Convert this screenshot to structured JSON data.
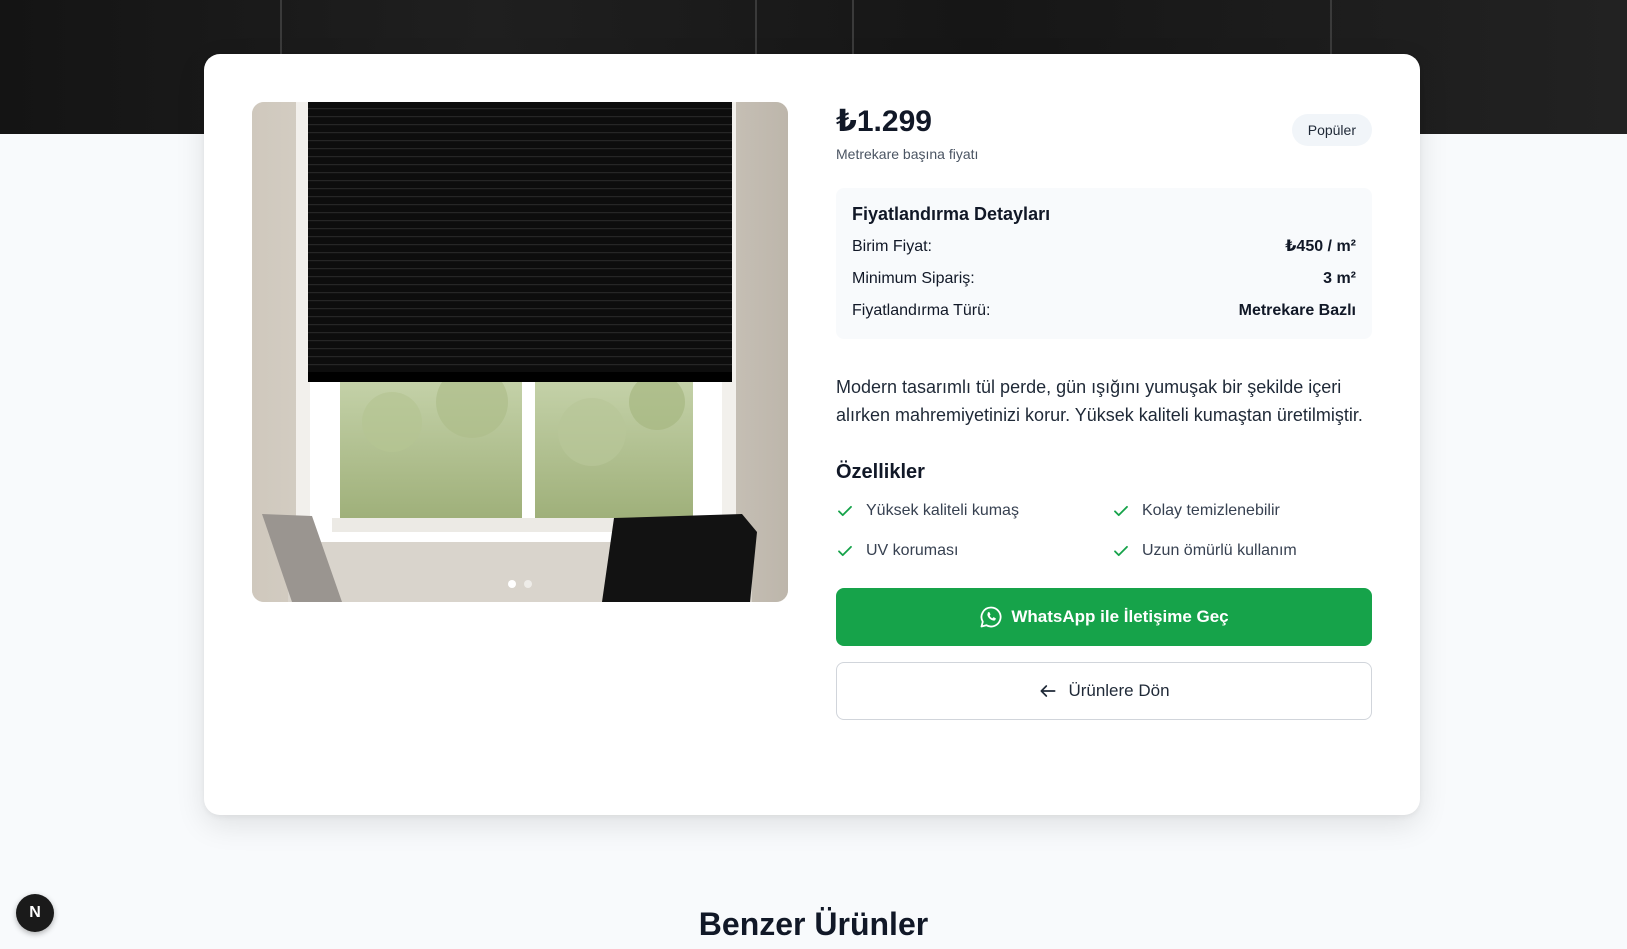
{
  "product": {
    "price": "₺1.299",
    "price_caption": "Metrekare başına fiyatı",
    "badge": "Popüler",
    "pricing_details": {
      "title": "Fiyatlandırma Detayları",
      "rows": [
        {
          "label": "Birim Fiyat:",
          "value": "₺450 / m²"
        },
        {
          "label": "Minimum Sipariş:",
          "value": "3 m²"
        },
        {
          "label": "Fiyatlandırma Türü:",
          "value": "Metrekare Bazlı"
        }
      ]
    },
    "description": "Modern tasarımlı tül perde, gün ışığını yumuşak bir şekilde içeri alırken mahremiyetinizi korur. Yüksek kaliteli kumaştan üretilmiştir.",
    "features_title": "Özellikler",
    "features": [
      "Yüksek kaliteli kumaş",
      "Kolay temizlenebilir",
      "UV koruması",
      "Uzun ömürlü kullanım"
    ],
    "gallery": {
      "image_count": 2,
      "active_index": 0
    }
  },
  "actions": {
    "whatsapp_label": "WhatsApp ile İletişime Geç",
    "back_label": "Ürünlere Dön"
  },
  "similar_section_title": "Benzer Ürünler",
  "dev_badge": "N",
  "colors": {
    "whatsapp_green": "#16a34a",
    "check_green": "#16a34a",
    "blind_black": "#0f0f0f"
  },
  "icons": [
    "check-icon",
    "whatsapp-icon",
    "arrow-left-icon"
  ]
}
